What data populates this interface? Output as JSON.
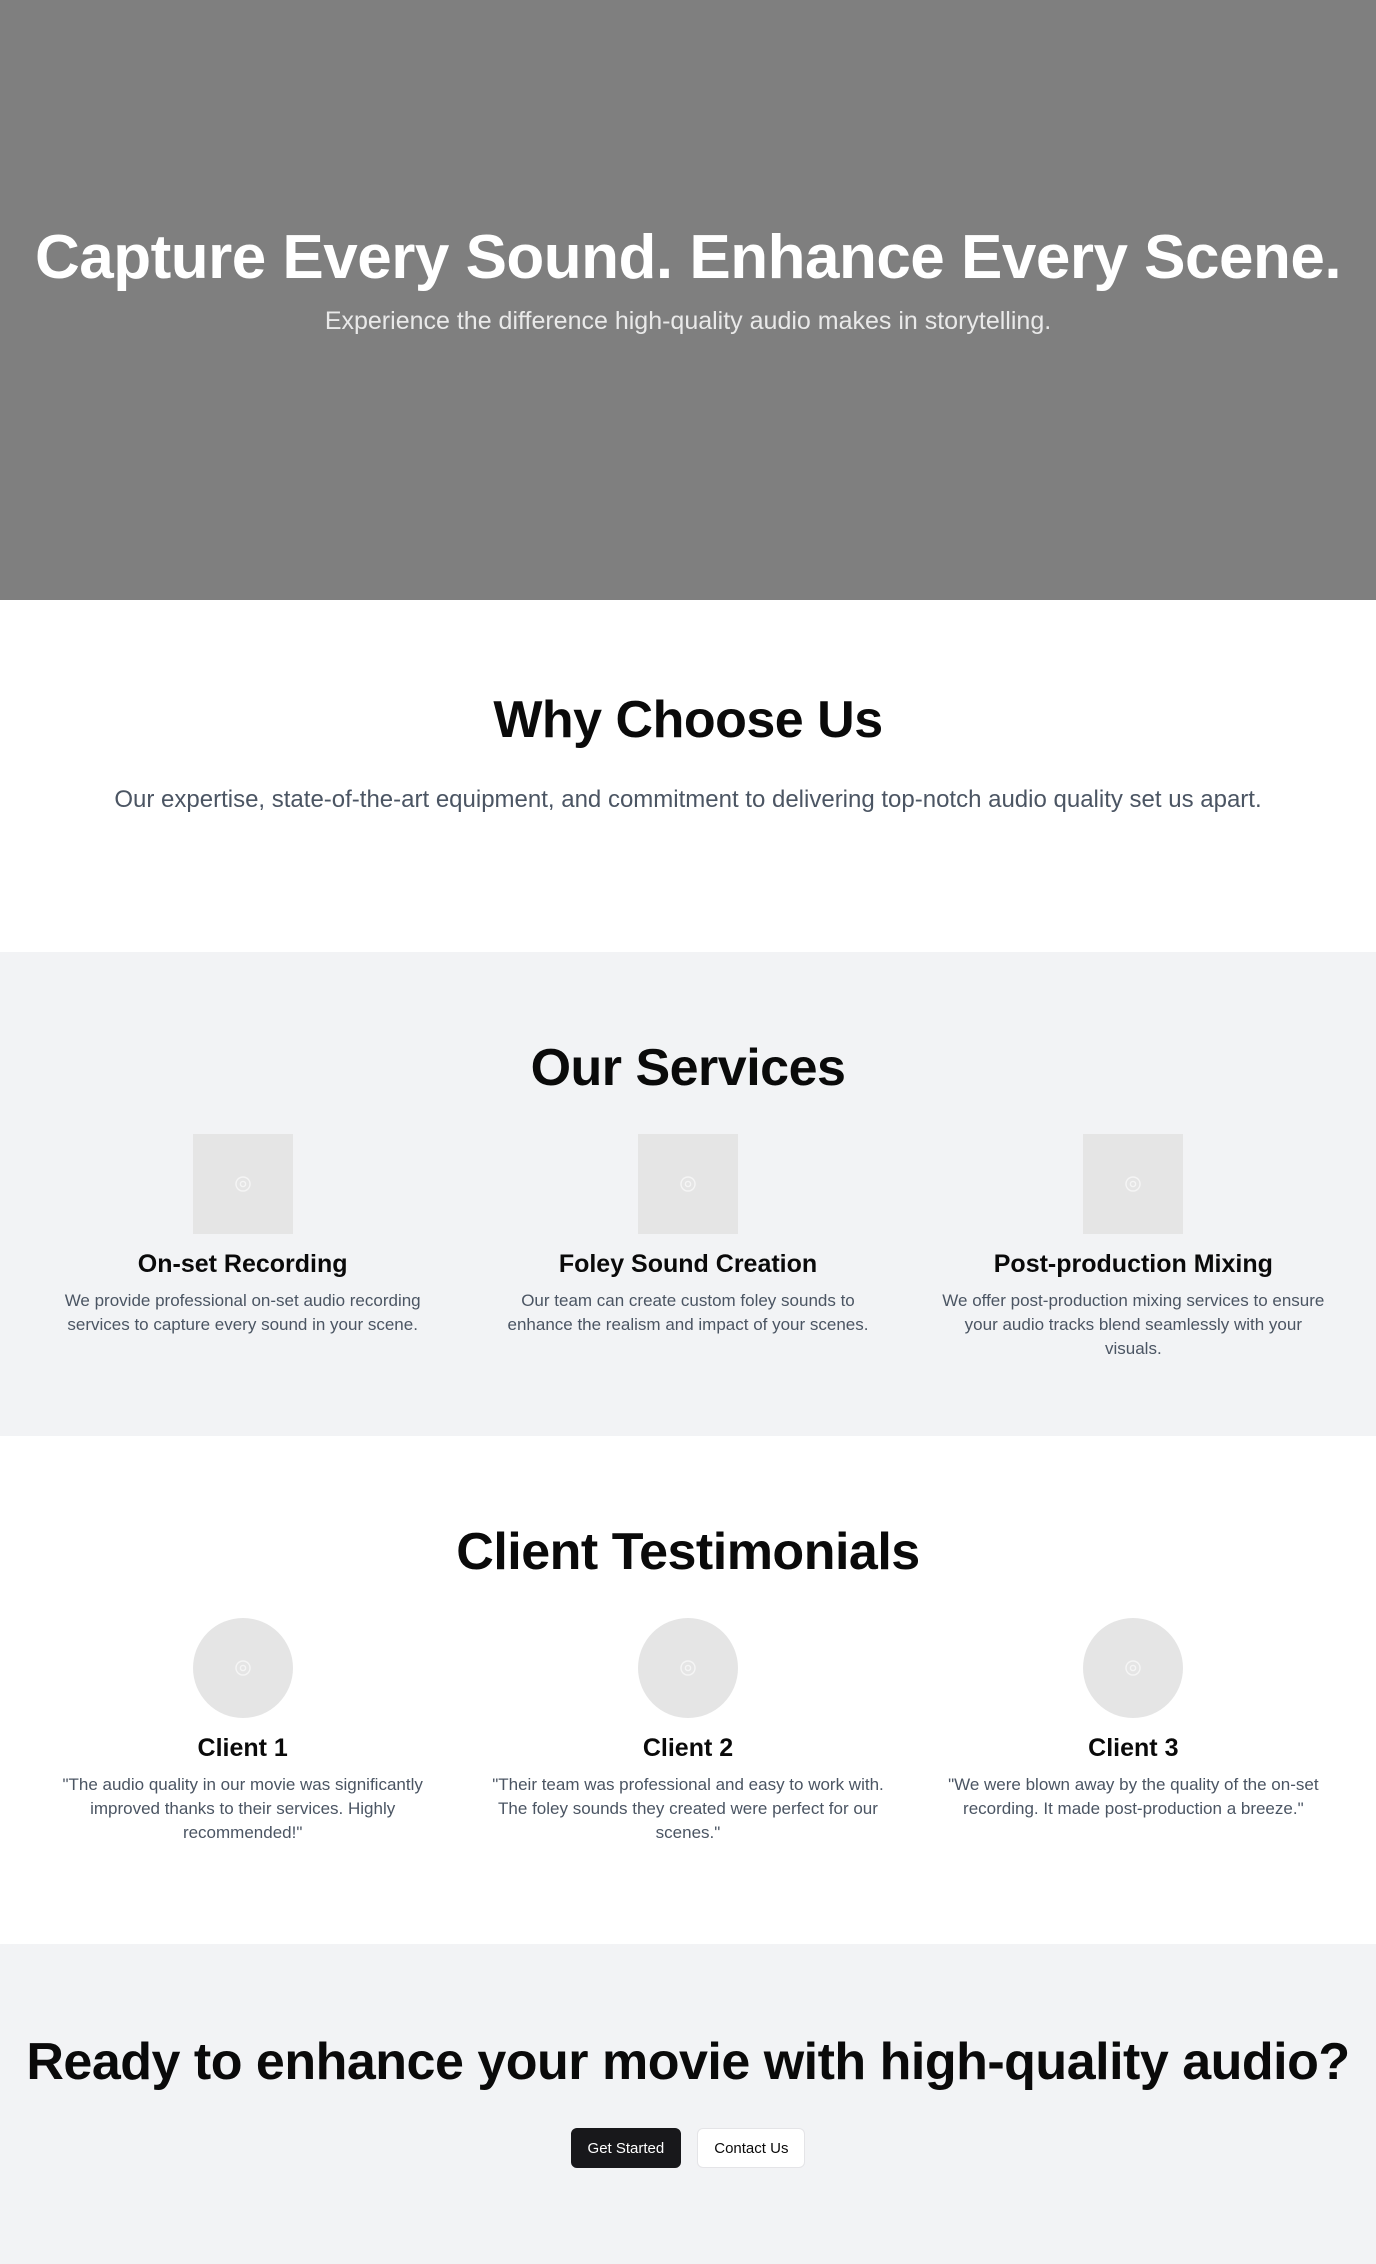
{
  "hero": {
    "title": "Capture Every Sound. Enhance Every Scene.",
    "subtitle": "Experience the difference high-quality audio makes in storytelling."
  },
  "why": {
    "title": "Why Choose Us",
    "text": "Our expertise, state-of-the-art equipment, and commitment to delivering top-notch audio quality set us apart."
  },
  "services": {
    "title": "Our Services",
    "items": [
      {
        "icon": "image-placeholder-icon",
        "title": "On-set Recording",
        "text": "We provide professional on-set audio recording services to capture every sound in your scene."
      },
      {
        "icon": "image-placeholder-icon",
        "title": "Foley Sound Creation",
        "text": "Our team can create custom foley sounds to enhance the realism and impact of your scenes."
      },
      {
        "icon": "image-placeholder-icon",
        "title": "Post-production Mixing",
        "text": "We offer post-production mixing services to ensure your audio tracks blend seamlessly with your visuals."
      }
    ]
  },
  "testimonials": {
    "title": "Client Testimonials",
    "items": [
      {
        "icon": "avatar-placeholder-icon",
        "name": "Client 1",
        "quote": "\"The audio quality in our movie was significantly improved thanks to their services. Highly recommended!\""
      },
      {
        "icon": "avatar-placeholder-icon",
        "name": "Client 2",
        "quote": "\"Their team was professional and easy to work with. The foley sounds they created were perfect for our scenes.\""
      },
      {
        "icon": "avatar-placeholder-icon",
        "name": "Client 3",
        "quote": "\"We were blown away by the quality of the on-set recording. It made post-production a breeze.\""
      }
    ]
  },
  "cta": {
    "title": "Ready to enhance your movie with high-quality audio?",
    "primary_label": "Get Started",
    "secondary_label": "Contact Us"
  },
  "colors": {
    "hero_bg": "#7f7f7f",
    "section_alt_bg": "#f2f3f5",
    "primary_button": "#18181b"
  }
}
